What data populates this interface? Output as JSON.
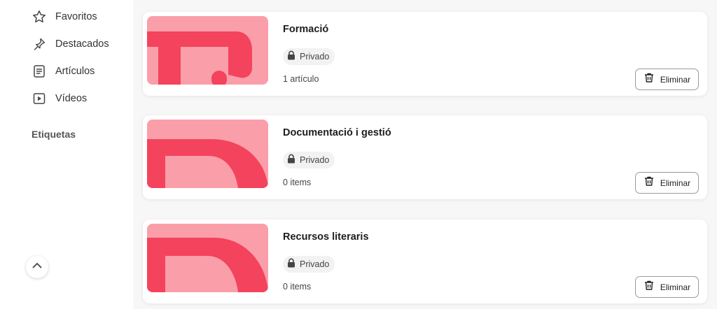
{
  "sidebar": {
    "items": [
      {
        "label": "Favoritos",
        "icon": "star-icon"
      },
      {
        "label": "Destacados",
        "icon": "pin-icon"
      },
      {
        "label": "Artículos",
        "icon": "article-icon"
      },
      {
        "label": "Vídeos",
        "icon": "video-icon"
      }
    ],
    "tags_title": "Etiquetas",
    "scroll_up_icon": "chevron-up-icon"
  },
  "collections": [
    {
      "title": "Formació",
      "visibility": "Privado",
      "count": "1 artículo",
      "delete_label": "Eliminar"
    },
    {
      "title": "Documentació i gestió",
      "visibility": "Privado",
      "count": "0 items",
      "delete_label": "Eliminar"
    },
    {
      "title": "Recursos literaris",
      "visibility": "Privado",
      "count": "0 items",
      "delete_label": "Eliminar"
    }
  ],
  "colors": {
    "thumb_background": "#fa9fa9",
    "thumb_accent": "#f4435d"
  }
}
